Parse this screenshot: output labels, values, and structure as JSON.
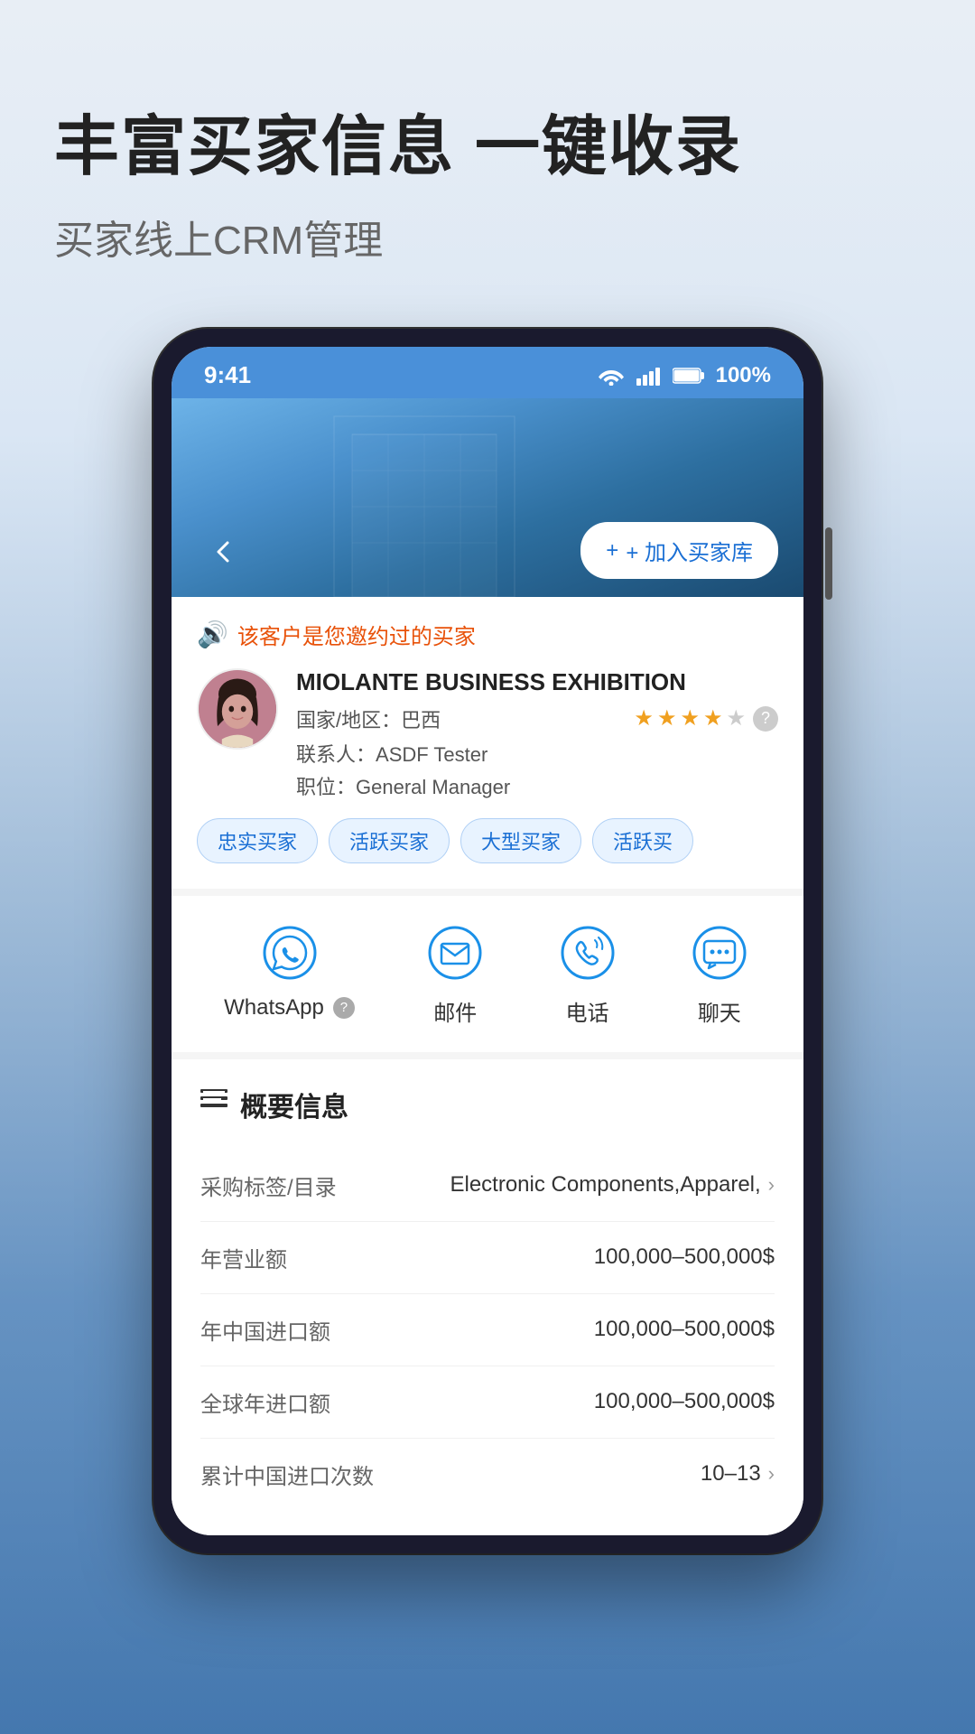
{
  "headline": "丰富买家信息 一键收录",
  "subheadline": "买家线上CRM管理",
  "phone": {
    "status_bar": {
      "time": "9:41",
      "battery": "100%"
    },
    "hero": {
      "back_label": "‹",
      "add_btn_label": "+ 加入买家库"
    },
    "customer_card": {
      "notice": "该客户是您邀约过的买家",
      "company_name": "MIOLANTE BUSINESS EXHIBITION",
      "country_label": "国家/地区：",
      "country": "巴西",
      "stars": 4,
      "total_stars": 5,
      "contact_label": "联系人：",
      "contact_name": "ASDF Tester",
      "position_label": "职位：",
      "position": "General Manager",
      "tags": [
        "忠实买家",
        "活跃买家",
        "大型买家",
        "活跃买"
      ]
    },
    "actions": [
      {
        "id": "whatsapp",
        "label": "WhatsApp",
        "has_help": true
      },
      {
        "id": "email",
        "label": "邮件",
        "has_help": false
      },
      {
        "id": "phone",
        "label": "电话",
        "has_help": false
      },
      {
        "id": "chat",
        "label": "聊天",
        "has_help": false
      }
    ],
    "overview": {
      "title": "概要信息",
      "rows": [
        {
          "label": "采购标签/目录",
          "value": "Electronic Components,Apparel,",
          "has_arrow": true
        },
        {
          "label": "年营业额",
          "value": "100,000–500,000$",
          "has_arrow": false
        },
        {
          "label": "年中国进口额",
          "value": "100,000–500,000$",
          "has_arrow": false
        },
        {
          "label": "全球年进口额",
          "value": "100,000–500,000$",
          "has_arrow": false
        },
        {
          "label": "累计中国进口次数",
          "value": "10–13",
          "has_arrow": true
        }
      ]
    }
  }
}
